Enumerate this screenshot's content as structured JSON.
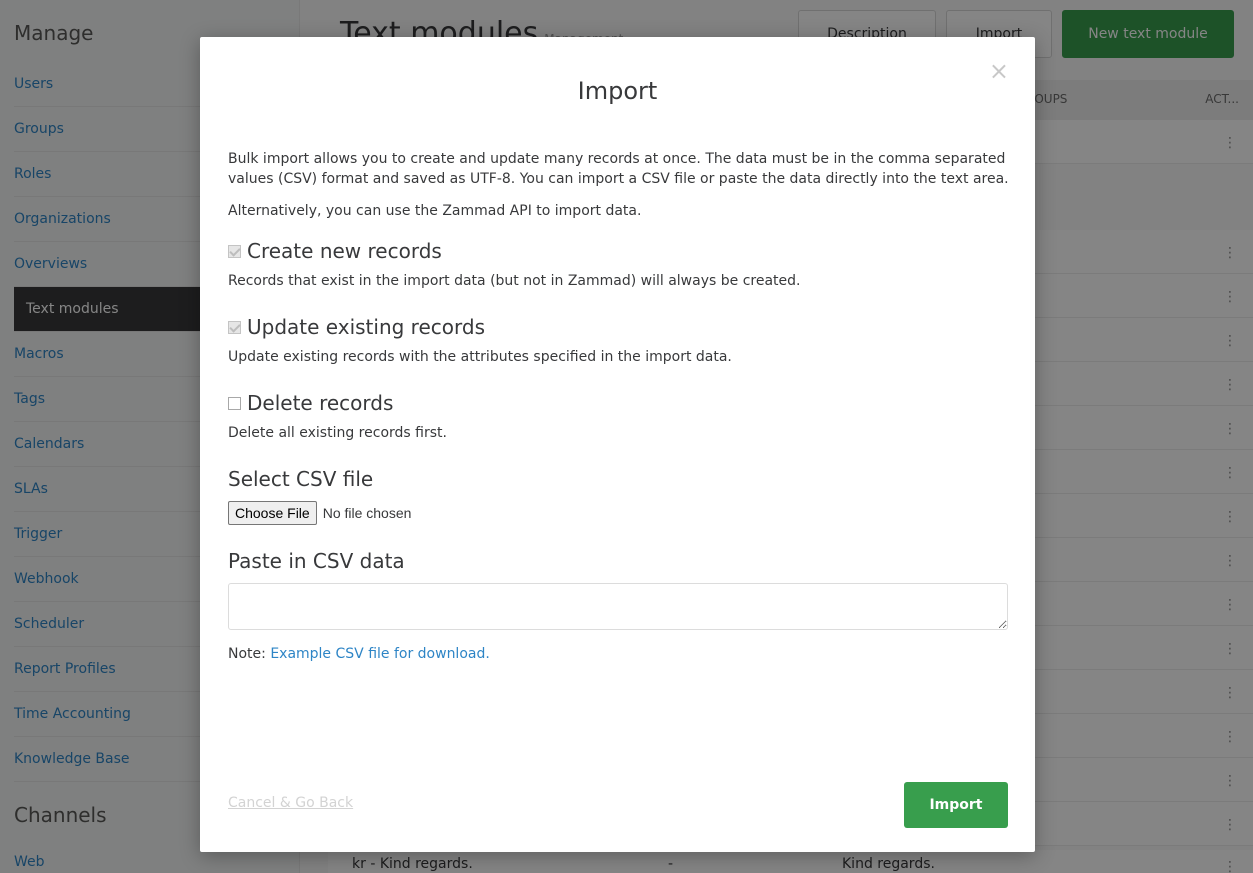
{
  "sidebar": {
    "manage_title": "Manage",
    "items": [
      {
        "label": "Users"
      },
      {
        "label": "Groups"
      },
      {
        "label": "Roles"
      },
      {
        "label": "Organizations"
      },
      {
        "label": "Overviews"
      },
      {
        "label": "Text modules"
      },
      {
        "label": "Macros"
      },
      {
        "label": "Tags"
      },
      {
        "label": "Calendars"
      },
      {
        "label": "SLAs"
      },
      {
        "label": "Trigger"
      },
      {
        "label": "Webhook"
      },
      {
        "label": "Scheduler"
      },
      {
        "label": "Report Profiles"
      },
      {
        "label": "Time Accounting"
      },
      {
        "label": "Knowledge Base"
      }
    ],
    "channels_title": "Channels",
    "channels_first": "Web"
  },
  "main": {
    "title": "Text modules",
    "subtitle": "Management",
    "description_button": "Description",
    "import_button": "Import",
    "new_button": "New text module",
    "column_groups": "ROUPS",
    "column_action": "ACT...",
    "last_row": {
      "name": "kr - Kind regards.",
      "keywords": "-",
      "content": "Kind regards."
    },
    "dots": "⋮"
  },
  "modal": {
    "title": "Import",
    "close": "×",
    "intro": "Bulk import allows you to create and update many records at once. The data must be in the comma separated values (CSV) format and saved as UTF-8. You can import a CSV file or paste the data directly into the text area.",
    "alternative": "Alternatively, you can use the Zammad API to import data.",
    "create_label": "Create new records",
    "create_checked": true,
    "create_help": "Records that exist in the import data (but not in Zammad) will always be created.",
    "update_label": "Update existing records",
    "update_checked": true,
    "update_help": "Update existing records with the attributes specified in the import data.",
    "delete_label": "Delete records",
    "delete_checked": false,
    "delete_help": "Delete all existing records first.",
    "select_csv_label": "Select CSV file",
    "choose_file_button": "Choose File",
    "no_file_text": "No file chosen",
    "paste_label": "Paste in CSV data",
    "paste_value": "",
    "note_prefix": "Note:",
    "note_link": "Example CSV file for download.",
    "cancel_link": "Cancel & Go Back",
    "import_button": "Import"
  },
  "colors": {
    "accent_green": "#389e4d",
    "link_blue": "#2e85c6",
    "active_nav": "#38393b"
  }
}
